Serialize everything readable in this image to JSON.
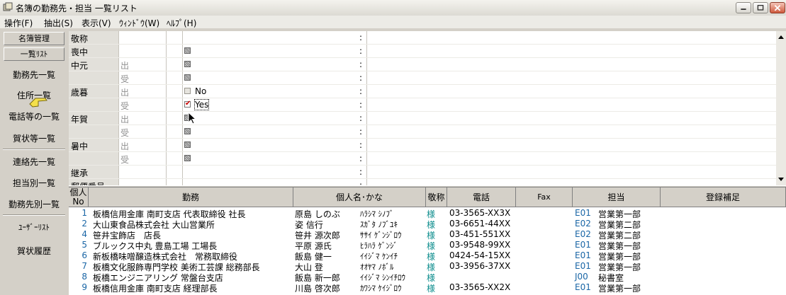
{
  "window": {
    "title": "名簿の勤務先・担当 一覧リスト",
    "controls": [
      "minimize",
      "maximize",
      "close"
    ]
  },
  "menu": [
    "操作(F)",
    "抽出(S)",
    "表示(V)",
    "ｳｨﾝﾄﾞｳ(W)",
    "ﾍﾙﾌﾟ(H)"
  ],
  "nav": {
    "btn1": "名簿管理",
    "btn2": "一覧ﾘｽﾄ",
    "items": [
      "勤務先一覧",
      "住所一覧",
      "電話等の一覧",
      "賀状等一覧",
      "連絡先一覧",
      "担当別一覧",
      "勤務先別一覧",
      "ﾕｰｻﾞｰﾘｽﾄ",
      "賀状履歴"
    ]
  },
  "upper": {
    "rows": [
      {
        "cat": "敬称",
        "dir": "",
        "check": "none",
        "text": ""
      },
      {
        "cat": "喪中",
        "dir": "",
        "check": "mixed",
        "text": ""
      },
      {
        "cat": "中元",
        "dir": "出",
        "check": "mixed",
        "text": ""
      },
      {
        "cat": "",
        "dir": "受",
        "check": "mixed",
        "text": ""
      },
      {
        "cat": "歳暮",
        "dir": "出",
        "check": "empty",
        "text": "No"
      },
      {
        "cat": "",
        "dir": "受",
        "check": "checked",
        "text": "Yes"
      },
      {
        "cat": "年賀",
        "dir": "出",
        "check": "mixed",
        "text": ""
      },
      {
        "cat": "",
        "dir": "受",
        "check": "mixed",
        "text": ""
      },
      {
        "cat": "暑中",
        "dir": "出",
        "check": "mixed",
        "text": ""
      },
      {
        "cat": "",
        "dir": "受",
        "check": "mixed",
        "text": ""
      },
      {
        "cat": "継承",
        "dir": "",
        "check": "none",
        "text": ""
      },
      {
        "cat": "郵便番号",
        "dir": "",
        "check": "none",
        "text": ""
      }
    ],
    "colon": ":"
  },
  "grid": {
    "headers": {
      "no_line1": "個人",
      "no_line2": "No",
      "kinmu": "勤務",
      "name": "個人名･かな",
      "keisho": "敬称",
      "tel": "電話",
      "fax": "Fax",
      "tanto": "担当",
      "hosoku": "登録補足"
    },
    "rows": [
      {
        "no": "1",
        "kinmu": "板橋信用金庫 南町支店 代表取締役 社長",
        "name": "原島 しのぶ",
        "kana": "ﾊﾗｼﾏ ｼﾉﾌﾞ",
        "keisho": "様",
        "tel": "03-3565-XX3X",
        "code": "E01",
        "dept": "営業第一部"
      },
      {
        "no": "2",
        "kinmu": "大山東食品株式会社 大山営業所",
        "name": "姿 信行",
        "kana": "ｽｶﾞﾀ ﾉﾌﾞﾕｷ",
        "keisho": "様",
        "tel": "03-6651-44XX",
        "code": "E02",
        "dept": "営業第二部"
      },
      {
        "no": "4",
        "kinmu": "笹井宝飾店　店長",
        "name": "笹井 源次郎",
        "kana": "ｻｻｲ ｹﾞﾝｼﾞﾛｳ",
        "keisho": "様",
        "tel": "03-451-551XX",
        "code": "E02",
        "dept": "営業第二部"
      },
      {
        "no": "5",
        "kinmu": "ブルックス中丸 豊島工場 工場長",
        "name": "平原 源氏",
        "kana": "ﾋﾗﾊﾗ ｹﾞﾝｼﾞ",
        "keisho": "様",
        "tel": "03-9548-99XX",
        "code": "E01",
        "dept": "営業第一部"
      },
      {
        "no": "6",
        "kinmu": "新板橋味噌醸造株式会社　常務取締役",
        "name": "飯島 健一",
        "kana": "ｲｲｼﾞﾏ ｹﾝｲﾁ",
        "keisho": "様",
        "tel": "0424-54-15XX",
        "code": "E01",
        "dept": "営業第一部"
      },
      {
        "no": "7",
        "kinmu": "板橋文化服飾専門学校 美術工芸課 総務部長",
        "name": "大山 登",
        "kana": "ｵｵﾔﾏ ﾉﾎﾞﾙ",
        "keisho": "様",
        "tel": "03-3956-37XX",
        "code": "E01",
        "dept": "営業第一部"
      },
      {
        "no": "8",
        "kinmu": "板橋エンジニアリング 常盤台支店",
        "name": "飯島 新一郎",
        "kana": "ｲｲｼﾞﾏ ｼﾝｲﾁﾛｳ",
        "keisho": "様",
        "tel": "",
        "code": "J00",
        "dept": "秘書室"
      },
      {
        "no": "9",
        "kinmu": "板橋信用金庫 南町支店 経理部長",
        "name": "川島 啓次郎",
        "kana": "ｶﾜｼﾏ ｹｲｼﾞﾛｳ",
        "keisho": "様",
        "tel": "03-3565-XX2X",
        "code": "E01",
        "dept": "営業第一部"
      }
    ]
  },
  "colors": {
    "link": "#1a66a6",
    "keisho": "#0b8c8c",
    "check": "#cc0000"
  }
}
